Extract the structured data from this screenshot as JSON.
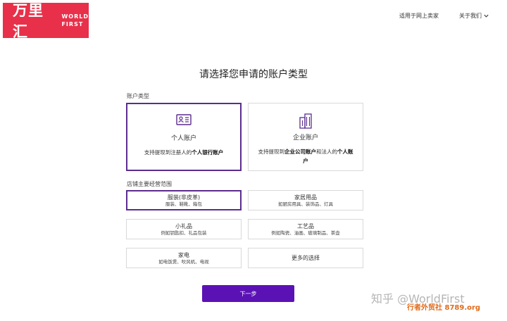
{
  "header": {
    "logo_cn": "万里汇",
    "logo_en_line1": "WORLD",
    "logo_en_line2": "FIRST",
    "nav_sellers": "适用于网上卖家",
    "nav_about": "关于我们"
  },
  "title": "请选择您申请的账户类型",
  "account_section_label": "账户类型",
  "account_types": [
    {
      "name": "个人账户",
      "desc_prefix": "支持提现到注册人的",
      "desc_bold": "个人银行账户",
      "desc_suffix": "",
      "icon": "id-card-icon",
      "selected": true
    },
    {
      "name": "企业账户",
      "desc_prefix": "支持提现到",
      "desc_bold": "企业公司账户",
      "desc_mid": "和法人的",
      "desc_bold2": "个人账户",
      "icon": "building-icon",
      "selected": false
    }
  ],
  "store_section_label": "店铺主要经营范围",
  "store_categories": [
    {
      "name": "服装(非皮革)",
      "sub": "服装、鞋靴、箱包",
      "selected": true
    },
    {
      "name": "家居用品",
      "sub": "如厨房用具、装饰品、灯具",
      "selected": false
    },
    {
      "name": "小礼品",
      "sub": "例如钥匙扣、礼品包装",
      "selected": false
    },
    {
      "name": "工艺品",
      "sub": "例如陶瓷、油画、玻璃制品、茶壶",
      "selected": false
    },
    {
      "name": "家电",
      "sub": "如电饭煲、吹风机、电视",
      "selected": false
    },
    {
      "name": "更多的选择",
      "sub": "",
      "selected": false
    }
  ],
  "next_button": "下一步",
  "watermark": {
    "line1": "知乎 @WorldFirst",
    "line2": "行者外贸社 8789.org"
  },
  "colors": {
    "brand_red": "#e8304a",
    "accent_purple": "#5b2c8f",
    "button_purple": "#5b12b5"
  }
}
